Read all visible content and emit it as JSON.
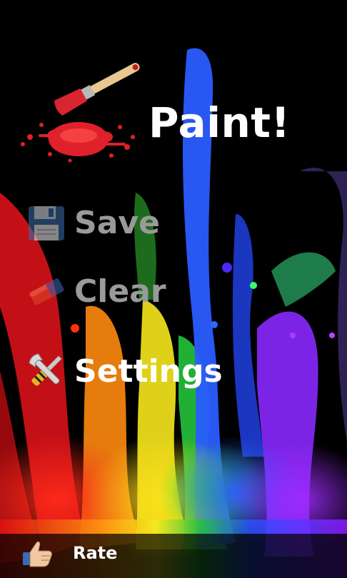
{
  "app": {
    "title": "Paint!"
  },
  "menu": {
    "save": {
      "label": "Save",
      "icon": "floppy-disk-icon",
      "enabled": false
    },
    "clear": {
      "label": "Clear",
      "icon": "eraser-icon",
      "enabled": false
    },
    "settings": {
      "label": "Settings",
      "icon": "wrench-screwdriver-icon",
      "enabled": true
    }
  },
  "footer": {
    "rate_label": "Rate",
    "rate_icon": "thumbs-up-icon"
  },
  "colors": {
    "title": "#ffffff",
    "enabled_text": "#ffffff",
    "disabled_text": "#9a9a9a",
    "background": "#000000",
    "splash_red": "#e0202a"
  }
}
